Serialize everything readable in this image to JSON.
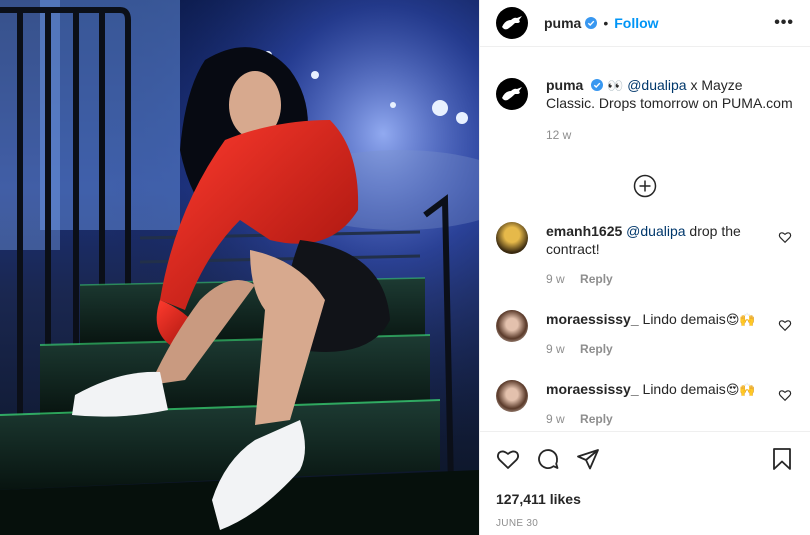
{
  "post": {
    "account": "puma",
    "follow_label": "Follow",
    "separator": "•",
    "more_label": "•••"
  },
  "caption": {
    "username": "puma",
    "emoji": "👀",
    "mention": "@dualipa",
    "text": " x Mayze Classic. Drops tomorrow on PUMA.com",
    "age": "12 w"
  },
  "comments": [
    {
      "username": "emanh1625",
      "mention": "@dualipa",
      "text": " drop the contract!",
      "age": "9 w",
      "reply_label": "Reply"
    },
    {
      "username": "moraessissy_",
      "mention": "",
      "text": "Lindo demais",
      "emoji": "😍🙌",
      "age": "9 w",
      "reply_label": "Reply"
    },
    {
      "username": "moraessissy_",
      "mention": "",
      "text": "Lindo demais",
      "emoji": "😍🙌",
      "age": "9 w",
      "reply_label": "Reply"
    }
  ],
  "stats": {
    "likes": "127,411 likes",
    "date": "JUNE 30"
  },
  "colors": {
    "accent": "#0095f6",
    "mention": "#00376b",
    "muted": "#8e8e8e",
    "jacket": "#d8231c"
  }
}
